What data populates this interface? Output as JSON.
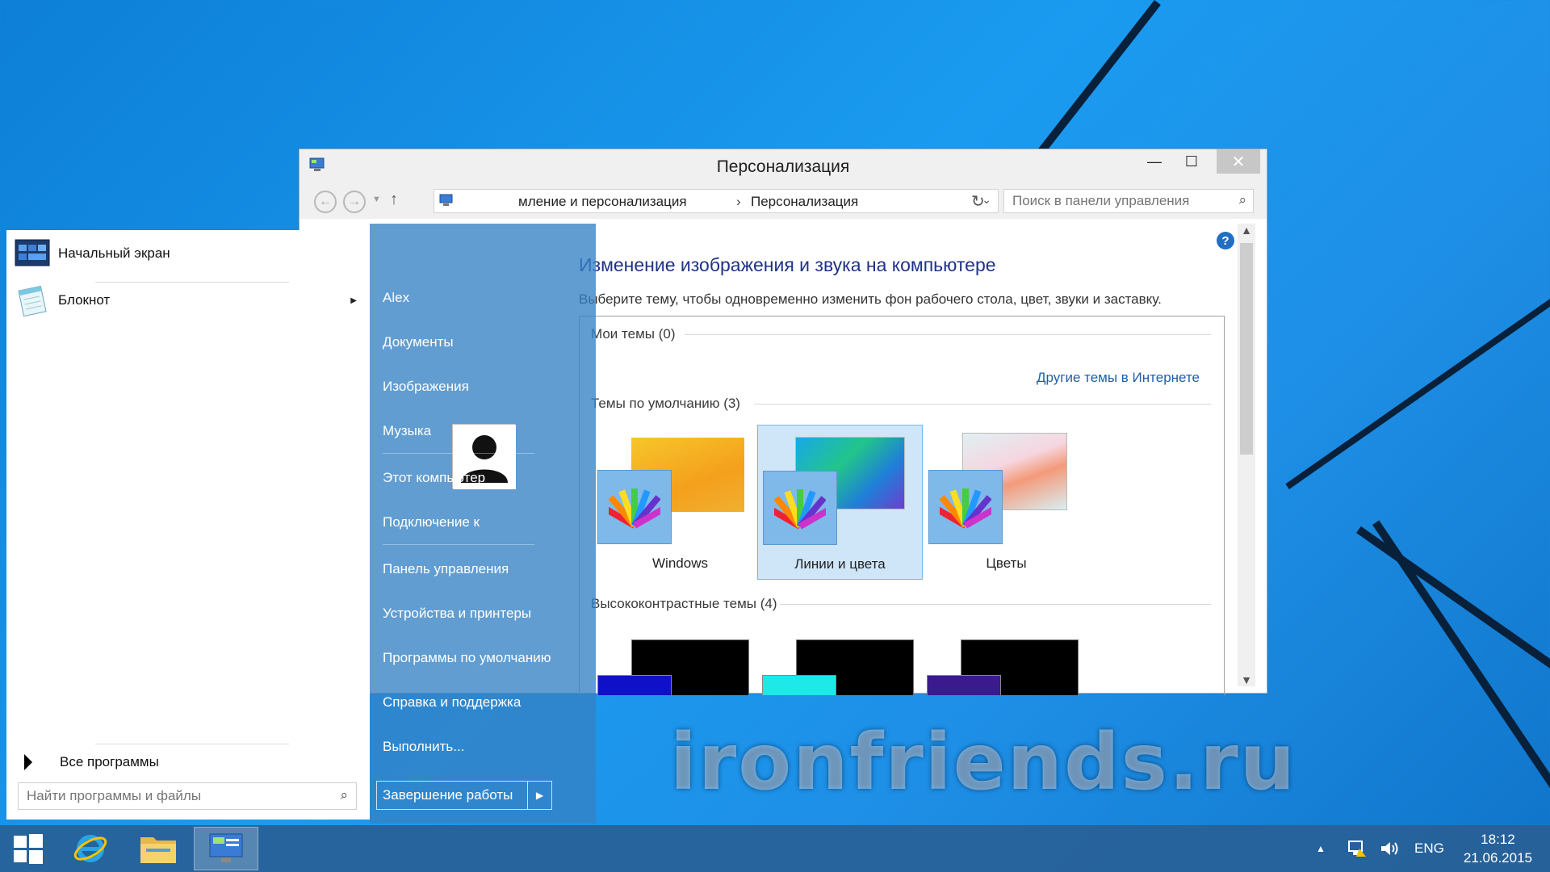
{
  "window": {
    "title": "Персонализация",
    "minimize_glyph": "—",
    "maximize_glyph": "☐",
    "close_glyph": "✕",
    "breadcrumb_1": "мление и персонализация",
    "breadcrumb_sep": "›",
    "breadcrumb_2": "Персонализация",
    "search_placeholder": "Поиск в панели управления",
    "heading": "Изменение изображения и звука на компьютере",
    "subtext": "Выберите тему, чтобы одновременно изменить фон рабочего стола, цвет, звуки и заставку.",
    "my_themes": "Мои темы (0)",
    "more_themes_link": "Другие темы в Интернете",
    "default_themes": "Темы по умолчанию (3)",
    "high_contrast": "Высококонтрастные темы (4)",
    "themes": [
      {
        "label": "Windows",
        "selected": false
      },
      {
        "label": "Линии и цвета",
        "selected": true
      },
      {
        "label": "Цветы",
        "selected": false
      }
    ],
    "help_glyph": "?"
  },
  "start_menu": {
    "pinned": [
      {
        "label": "Начальный экран",
        "icon": "start-screen-icon"
      },
      {
        "label": "Блокнот",
        "icon": "notepad-icon",
        "has_submenu": true
      }
    ],
    "all_programs": "Все программы",
    "search_placeholder": "Найти программы и файлы",
    "right_links": [
      "Alex",
      "Документы",
      "Изображения",
      "Музыка",
      "Этот компьютер",
      "Подключение к",
      "Панель управления",
      "Устройства и принтеры",
      "Программы по умолчанию",
      "Справка и поддержка",
      "Выполнить..."
    ],
    "shutdown_label": "Завершение работы"
  },
  "taskbar": {
    "language": "ENG",
    "time": "18:12",
    "date": "21.06.2015",
    "apps": [
      "start-button",
      "internet-explorer",
      "file-explorer",
      "control-panel"
    ]
  },
  "watermark": "ironfriends.ru",
  "colors": {
    "accent": "#1f6fc4",
    "heading": "#1e3287",
    "link": "#1f5fa8",
    "start_right_panel": "#3481c4"
  }
}
